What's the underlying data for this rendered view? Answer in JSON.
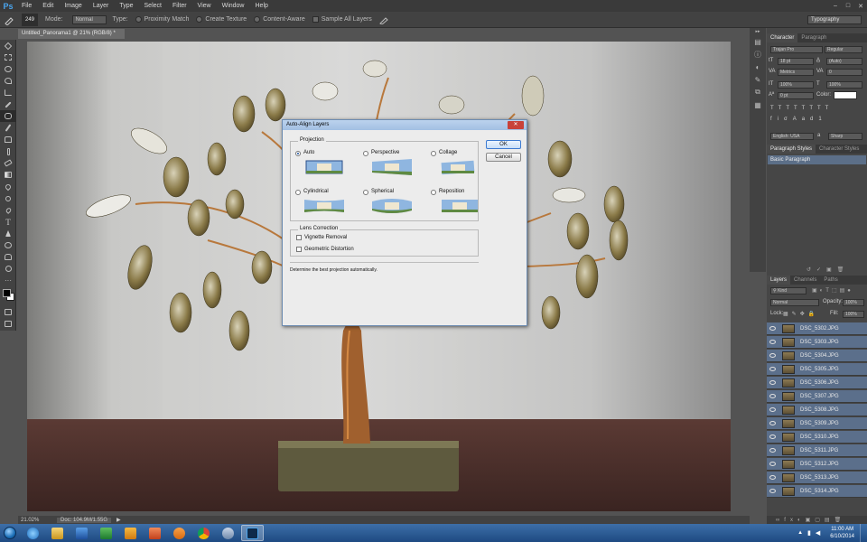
{
  "app": {
    "logo": "Ps"
  },
  "menu": [
    "File",
    "Edit",
    "Image",
    "Layer",
    "Type",
    "Select",
    "Filter",
    "View",
    "Window",
    "Help"
  ],
  "window_controls": [
    "–",
    "□",
    "✕"
  ],
  "options_bar": {
    "brush_size": "249",
    "mode_label": "Mode:",
    "mode_value": "Normal",
    "type_label": "Type:",
    "proximity_match": "Proximity Match",
    "create_texture": "Create Texture",
    "content_aware": "Content-Aware",
    "sample_all_layers": "Sample All Layers",
    "workspace": "Typography"
  },
  "document": {
    "tab_title": "Untitled_Panorama1 @ 21% (RGB/8) *"
  },
  "status": {
    "zoom": "21.02%",
    "doc_size": "Doc: 104.9M/1.55G"
  },
  "dialog": {
    "title": "Auto-Align Layers",
    "projection_label": "Projection",
    "options": [
      {
        "label": "Auto",
        "selected": true
      },
      {
        "label": "Perspective",
        "selected": false
      },
      {
        "label": "Collage",
        "selected": false
      },
      {
        "label": "Cylindrical",
        "selected": false
      },
      {
        "label": "Spherical",
        "selected": false
      },
      {
        "label": "Reposition",
        "selected": false
      }
    ],
    "lens_label": "Lens Correction",
    "vignette": "Vignette Removal",
    "geometric": "Geometric Distortion",
    "description": "Determine the best projection automatically.",
    "ok": "OK",
    "cancel": "Cancel"
  },
  "character_panel": {
    "tabs": [
      "Character",
      "Paragraph"
    ],
    "font_family": "Trajan Pro",
    "font_style": "Regular",
    "font_size": "18 pt",
    "leading": "(Auto)",
    "tracking_mode": "Metrics",
    "tracking": "0",
    "vertical_scale": "100%",
    "horizontal_scale": "100%",
    "baseline": "0 pt",
    "color_label": "Color:",
    "language": "English: USA",
    "antialias_icon": "a",
    "antialias": "Sharp"
  },
  "paragraph_styles": {
    "tabs": [
      "Paragraph Styles",
      "Character Styles"
    ],
    "item": "Basic Paragraph"
  },
  "layers_panel": {
    "tabs": [
      "Layers",
      "Channels",
      "Paths"
    ],
    "kind": "Kind",
    "blend": "Normal",
    "opacity_label": "Opacity:",
    "opacity": "100%",
    "lock_label": "Lock:",
    "fill_label": "Fill:",
    "fill": "100%",
    "layers": [
      "DSC_5302.JPG",
      "DSC_5303.JPG",
      "DSC_5304.JPG",
      "DSC_5305.JPG",
      "DSC_5306.JPG",
      "DSC_5307.JPG",
      "DSC_5308.JPG",
      "DSC_5309.JPG",
      "DSC_5310.JPG",
      "DSC_5311.JPG",
      "DSC_5312.JPG",
      "DSC_5313.JPG",
      "DSC_5314.JPG"
    ]
  },
  "taskbar": {
    "time": "11:00 AM",
    "date": "6/10/2014",
    "apps": [
      "ie-icon",
      "explorer-icon",
      "ftp-icon",
      "excel-icon",
      "outlook-icon",
      "powerpoint-icon",
      "media-player-icon",
      "chrome-icon",
      "game-icon",
      "photoshop-icon"
    ]
  },
  "colors": {
    "accent": "#5b6f8b",
    "panel": "#464646",
    "taskbar": "#2a5a95"
  }
}
